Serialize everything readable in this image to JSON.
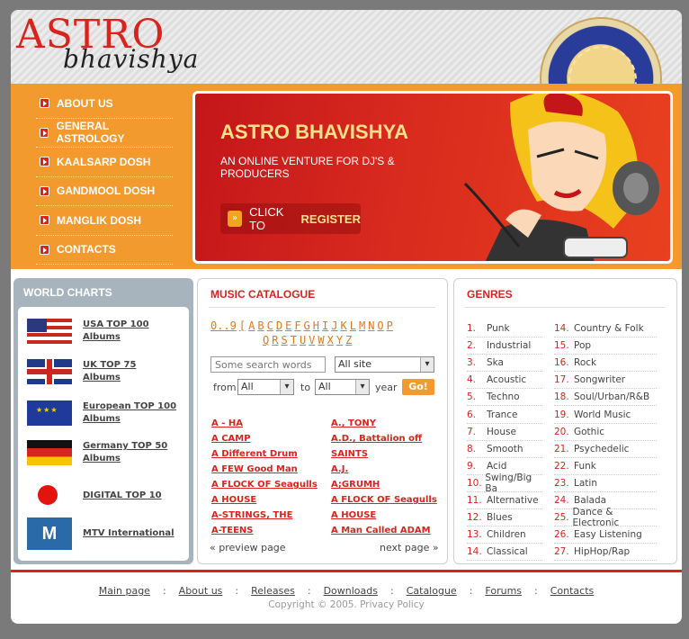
{
  "header": {
    "logo_main": "ASTRO",
    "logo_sub": "bhavishya"
  },
  "nav": [
    {
      "label": "ABOUT US"
    },
    {
      "label": "GENERAL ASTROLOGY"
    },
    {
      "label": "KAALSARP DOSH"
    },
    {
      "label": "GANDMOOL DOSH"
    },
    {
      "label": "MANGLIK DOSH"
    },
    {
      "label": "CONTACTS"
    }
  ],
  "banner": {
    "title": "ASTRO BHAVISHYA",
    "subtitle": "AN ONLINE VENTURE FOR DJ'S & PRODUCERS",
    "register_prefix": "CLICK TO",
    "register_action": "REGISTER",
    "colors": {
      "title": "#fbe28a",
      "background": "#d92b1e"
    }
  },
  "world_charts": {
    "title": "WORLD CHARTS",
    "items": [
      {
        "icon": "usa-flag-icon",
        "label": "USA TOP 100 Albums"
      },
      {
        "icon": "uk-flag-icon",
        "label": "UK TOP 75 Albums"
      },
      {
        "icon": "eu-flag-icon",
        "label": "European TOP 100 Albums"
      },
      {
        "icon": "germany-flag-icon",
        "label": "Germany TOP 50 Albums"
      },
      {
        "icon": "digital-icon",
        "label": "DIGITAL TOP 10"
      },
      {
        "icon": "mtv-logo-icon",
        "label": "MTV International",
        "logo_text": "M"
      }
    ]
  },
  "catalogue": {
    "title": "MUSIC CATALOGUE",
    "alphabet_row1": [
      "0..9",
      "[",
      "A",
      "B",
      "C",
      "D",
      "E",
      "F",
      "G",
      "H",
      "I",
      "J",
      "K",
      "L",
      "M",
      "N",
      "O",
      "P"
    ],
    "alphabet_row2": [
      "Q",
      "R",
      "S",
      "T",
      "U",
      "V",
      "W",
      "X",
      "Y",
      "Z"
    ],
    "search_placeholder": "Some search words",
    "scope_selected": "All site",
    "from_label": "from",
    "from_selected": "All",
    "to_label": "to",
    "to_selected": "All",
    "year_label": "year",
    "go_label": "Go!",
    "artists_left": [
      "A - HA",
      "A CAMP",
      "A Different Drum",
      "A FEW Good Man",
      "A FLOCK OF Seagulls",
      "A HOUSE",
      "A-STRINGS, THE",
      "A-TEENS"
    ],
    "artists_right": [
      "A., TONY",
      "A.D., Battalion off",
      "SAINTS",
      "A.J.",
      "A;GRUMH",
      "A FLOCK OF Seagulls",
      "A HOUSE",
      "A Man Called ADAM"
    ],
    "prev_label": "« preview page",
    "next_label": "next page »"
  },
  "genres": {
    "title": "GENRES",
    "left": [
      {
        "num": "1.",
        "name": "Punk"
      },
      {
        "num": "2.",
        "name": "Industrial"
      },
      {
        "num": "3.",
        "name": "Ska"
      },
      {
        "num": "4.",
        "name": "Acoustic"
      },
      {
        "num": "5.",
        "name": "Techno"
      },
      {
        "num": "6.",
        "name": "Trance"
      },
      {
        "num": "7.",
        "name": "House"
      },
      {
        "num": "8.",
        "name": "Smooth"
      },
      {
        "num": "9.",
        "name": "Acid"
      },
      {
        "num": "10.",
        "name": "Swing/Big Ba"
      },
      {
        "num": "11.",
        "name": "Alternative"
      },
      {
        "num": "12.",
        "name": "Blues"
      },
      {
        "num": "13.",
        "name": "Children"
      },
      {
        "num": "14.",
        "name": "Classical"
      }
    ],
    "right": [
      {
        "num": "14.",
        "name": "Country & Folk"
      },
      {
        "num": "15.",
        "name": "Pop"
      },
      {
        "num": "16.",
        "name": "Rock"
      },
      {
        "num": "17.",
        "name": "Songwriter"
      },
      {
        "num": "18.",
        "name": "Soul/Urban/R&B"
      },
      {
        "num": "19.",
        "name": "World Music"
      },
      {
        "num": "20.",
        "name": "Gothic"
      },
      {
        "num": "21.",
        "name": "Psychedelic"
      },
      {
        "num": "22.",
        "name": "Funk"
      },
      {
        "num": "23.",
        "name": "Latin"
      },
      {
        "num": "24.",
        "name": "Balada"
      },
      {
        "num": "25.",
        "name": "Dance & Electronic"
      },
      {
        "num": "26.",
        "name": "Easy Listening"
      },
      {
        "num": "27.",
        "name": "HipHop/Rap"
      }
    ]
  },
  "footer": {
    "links": [
      "Main page",
      "About us",
      "Releases",
      "Downloads",
      "Catalogue",
      "Forums",
      "Contacts"
    ],
    "separator": ":",
    "copyright": "Copyright © 2005. Privacy Policy"
  },
  "colors": {
    "accent": "#d8241c",
    "orange": "#f29a2e",
    "charts_panel": "#a8b4bd"
  }
}
